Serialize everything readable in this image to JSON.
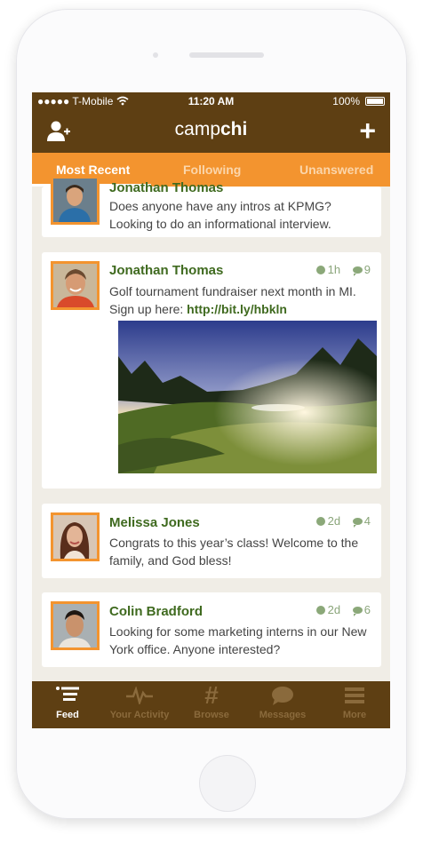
{
  "status_bar": {
    "carrier": "●●●●● T-Mobile",
    "time": "11:20 AM",
    "battery": "100%"
  },
  "header": {
    "logo_light": "camp",
    "logo_bold": "chi",
    "plus_label": "+"
  },
  "tabs": [
    "Most Recent",
    "Following",
    "Unanswered"
  ],
  "feed": {
    "partial_post": {
      "name": "Jonathan Thomas",
      "text": "Does anyone have any intros at KPMG? Looking to do an informational interview."
    },
    "posts": [
      {
        "name": "Jonathan Thomas",
        "time": "1h",
        "comments": "9",
        "text": "Golf tournament fundraiser next month in MI. Sign up here: ",
        "link": "http://bit.ly/hbkln"
      },
      {
        "name": "Melissa Jones",
        "time": "2d",
        "comments": "4",
        "text": "Congrats to this year’s class! Welcome to the family, and God bless!"
      },
      {
        "name": "Colin Bradford",
        "time": "2d",
        "comments": "6",
        "text": "Looking for some marketing interns in our New York office. Anyone interested?"
      }
    ]
  },
  "tabbar": [
    "Feed",
    "Your Activity",
    "Browse",
    "Messages",
    "More"
  ],
  "colors": {
    "brown": "#5e3f13",
    "orange": "#f3942f",
    "green_name": "#3f6a1f",
    "feed_bg": "#f0ede6"
  }
}
